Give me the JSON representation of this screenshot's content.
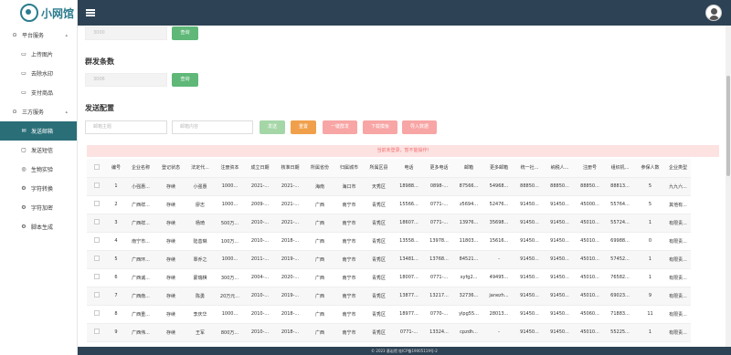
{
  "app": {
    "logo_text": "小网馆"
  },
  "sidebar": {
    "items": [
      {
        "label": "平台服务",
        "icon": "pin-icon",
        "group": true,
        "caret": "▴"
      },
      {
        "label": "上传图片",
        "icon": "image-icon"
      },
      {
        "label": "去除水印",
        "icon": "image-icon"
      },
      {
        "label": "支付商品",
        "icon": "image-icon"
      },
      {
        "label": "三方服务",
        "icon": "pin-icon",
        "group": true,
        "caret": "▴"
      },
      {
        "label": "发送邮箱",
        "icon": "mail-icon",
        "active": true
      },
      {
        "label": "发送短信",
        "icon": "chat-icon"
      },
      {
        "label": "生物实验",
        "icon": "check-circle-icon"
      },
      {
        "label": "字符转换",
        "icon": "gear-icon"
      },
      {
        "label": "字符加密",
        "icon": "gear-icon"
      },
      {
        "label": "脚本生成",
        "icon": "gear-icon"
      }
    ]
  },
  "top_query": {
    "input_value": "3000",
    "button": "查询"
  },
  "bulk": {
    "title": "群发条数",
    "input_value": "3006",
    "button": "查询"
  },
  "config": {
    "title": "发送配置",
    "subject_placeholder": "邮箱主题",
    "content_placeholder": "邮箱内容",
    "buttons": {
      "send": "发送",
      "reset": "重置",
      "one_click": "一键群发",
      "download": "下载模板",
      "import": "导入数据"
    }
  },
  "notice": "当前未登录，暂不能操作!",
  "table": {
    "headers": [
      "编号",
      "企业名称",
      "登记状态",
      "法定代...",
      "注册资本",
      "成立日期",
      "核准日期",
      "所属省份",
      "归属城市",
      "所属区县",
      "电话",
      "更多电话",
      "邮箱",
      "更多邮箱",
      "统一社...",
      "纳税人...",
      "注册号",
      "组织机...",
      "参保人数",
      "企业类型"
    ],
    "rows": [
      [
        "1",
        "小强惠...",
        "存续",
        "小强惠",
        "1000...",
        "2021-...",
        "2021-...",
        "海南",
        "海口市",
        "天秀区",
        "18988...",
        "0898-...",
        "87566...",
        "54968...",
        "88850...",
        "88850...",
        "88850...",
        "88813...",
        "5",
        "九九六..."
      ],
      [
        "2",
        "广西祥...",
        "存续",
        "廖志",
        "1000...",
        "2009-...",
        "2021-...",
        "广西",
        "南宁市",
        "青秀区",
        "15566...",
        "0771-...",
        "z5694...",
        "52476...",
        "91450...",
        "91450...",
        "45000...",
        "55764...",
        "5",
        "其他有..."
      ],
      [
        "3",
        "广西祥...",
        "存续",
        "杨琦",
        "500万...",
        "2010-...",
        "2021-...",
        "广西",
        "南宁市",
        "青秀区",
        "18607...",
        "0771-...",
        "13976...",
        "35698...",
        "91450...",
        "91450...",
        "45010...",
        "55724...",
        "1",
        "有限责..."
      ],
      [
        "4",
        "南宁市...",
        "存续",
        "陆善琳",
        "100万...",
        "2010-...",
        "2018-...",
        "广西",
        "南宁市",
        "青秀区",
        "13558...",
        "13978...",
        "11803...",
        "15616...",
        "91450...",
        "91450...",
        "45010...",
        "69988...",
        "0",
        "有限责..."
      ],
      [
        "5",
        "广西环...",
        "存续",
        "覃乔之",
        "1000...",
        "2011-...",
        "2019-...",
        "广西",
        "南宁市",
        "青秀区",
        "13481...",
        "13768...",
        "84521...",
        "-",
        "91450...",
        "91450...",
        "45010...",
        "57452...",
        "1",
        "有限责..."
      ],
      [
        "6",
        "广西诚...",
        "存续",
        "蒙瑞棋",
        "300万...",
        "2004-...",
        "2020-...",
        "广西",
        "南宁市",
        "青秀区",
        "18007...",
        "0771-...",
        "xyfg2...",
        "49495...",
        "91450...",
        "91450...",
        "45010...",
        "76582...",
        "1",
        "有限责..."
      ],
      [
        "7",
        "广西南...",
        "存续",
        "陈勇",
        "20万元...",
        "2010-...",
        "2019-...",
        "广西",
        "南宁市",
        "青秀区",
        "13877...",
        "13217...",
        "32736...",
        "janezh...",
        "91450...",
        "91450...",
        "45010...",
        "69023...",
        "9",
        "有限责..."
      ],
      [
        "8",
        "广西重...",
        "存续",
        "李庆华",
        "1000...",
        "2010-...",
        "2018-...",
        "广西",
        "南宁市",
        "青秀区",
        "18977...",
        "0770-...",
        "ylpg55...",
        "28013...",
        "91450...",
        "91450...",
        "45060...",
        "71883...",
        "11",
        "有限责..."
      ],
      [
        "9",
        "广西伟...",
        "存续",
        "王军",
        "800万...",
        "2010-...",
        "2018-...",
        "广西",
        "南宁市",
        "青秀区",
        "0771-...",
        "13324...",
        "cpzdh...",
        "-",
        "91450...",
        "91450...",
        "45010...",
        "55225...",
        "1",
        "有限责..."
      ]
    ]
  },
  "footer": "© 2023 基岩馆 桂ICP备19005119号-2"
}
